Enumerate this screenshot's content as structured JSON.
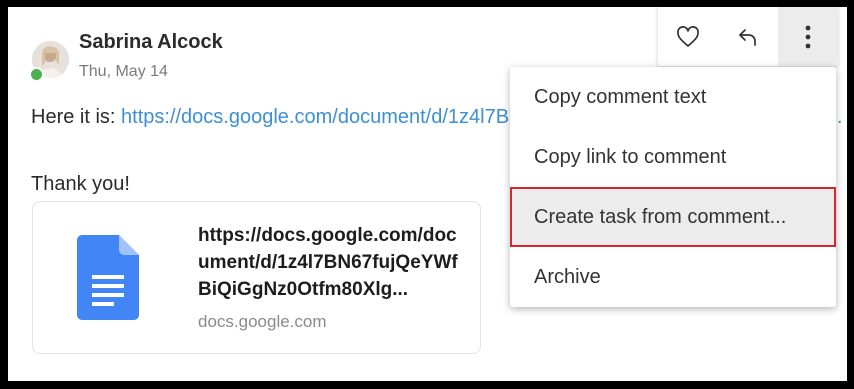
{
  "comment": {
    "author": "Sabrina Alcock",
    "date": "Thu, May 14",
    "body_prefix": "Here it is: ",
    "link_text": "https://docs.google.com/document/d/1z4l7BN67fujQeYWfBiQiGgNz0Otfm80Xlg...",
    "line2": "Thank you!"
  },
  "preview": {
    "title": "https://docs.google.com/document/d/1z4l7BN67fujQeYWfBiQiGgNz0Otfm80Xlg...",
    "domain": "docs.google.com",
    "icon": "google-docs-icon"
  },
  "toolbar": {
    "icons": [
      "heart-icon",
      "reply-icon",
      "more-vertical-icon"
    ]
  },
  "menu": {
    "items": [
      {
        "label": "Copy comment text"
      },
      {
        "label": "Copy link to comment"
      },
      {
        "label": "Create task from comment..."
      },
      {
        "label": "Archive"
      }
    ],
    "highlighted_index": 2
  },
  "colors": {
    "link": "#3d8fd6",
    "highlight_border": "#d7262d",
    "online": "#4caf50",
    "doc_icon": "#4285f4"
  }
}
